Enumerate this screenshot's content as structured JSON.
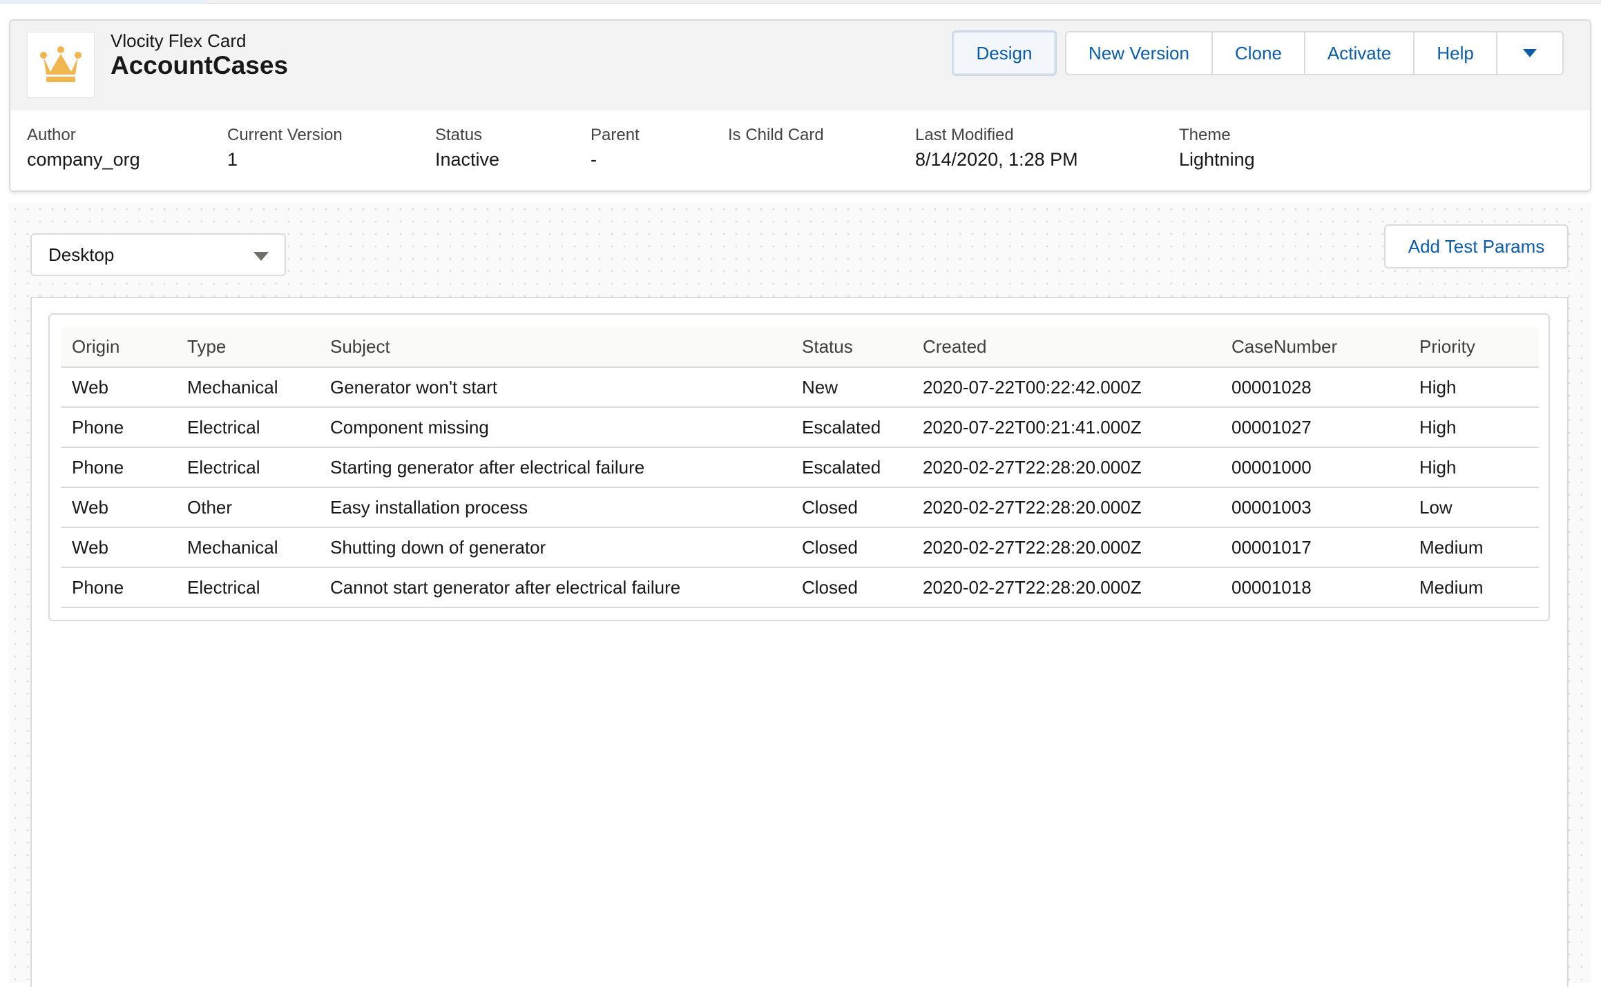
{
  "header": {
    "card_kind": "Vlocity Flex Card",
    "card_name": "AccountCases",
    "logo_icon": "crown-icon",
    "buttons": {
      "design": "Design",
      "new_version": "New Version",
      "clone": "Clone",
      "activate": "Activate",
      "help": "Help",
      "more_icon": "chevron-down-icon"
    },
    "meta": {
      "author": {
        "label": "Author",
        "value": "company_org"
      },
      "current_version": {
        "label": "Current Version",
        "value": "1"
      },
      "status": {
        "label": "Status",
        "value": "Inactive"
      },
      "parent": {
        "label": "Parent",
        "value": "-"
      },
      "is_child_card": {
        "label": "Is Child Card",
        "value": ""
      },
      "last_modified": {
        "label": "Last Modified",
        "value": "8/14/2020, 1:28 PM"
      },
      "theme": {
        "label": "Theme",
        "value": "Lightning"
      }
    }
  },
  "canvas": {
    "device_select": {
      "value": "Desktop"
    },
    "add_test_params": "Add Test Params"
  },
  "table": {
    "columns": [
      "Origin",
      "Type",
      "Subject",
      "Status",
      "Created",
      "CaseNumber",
      "Priority"
    ],
    "rows": [
      [
        "Web",
        "Mechanical",
        "Generator won't start",
        "New",
        "2020-07-22T00:22:42.000Z",
        "00001028",
        "High"
      ],
      [
        "Phone",
        "Electrical",
        "Component missing",
        "Escalated",
        "2020-07-22T00:21:41.000Z",
        "00001027",
        "High"
      ],
      [
        "Phone",
        "Electrical",
        "Starting generator after electrical failure",
        "Escalated",
        "2020-02-27T22:28:20.000Z",
        "00001000",
        "High"
      ],
      [
        "Web",
        "Other",
        "Easy installation process",
        "Closed",
        "2020-02-27T22:28:20.000Z",
        "00001003",
        "Low"
      ],
      [
        "Web",
        "Mechanical",
        "Shutting down of generator",
        "Closed",
        "2020-02-27T22:28:20.000Z",
        "00001017",
        "Medium"
      ],
      [
        "Phone",
        "Electrical",
        "Cannot start generator after electrical failure",
        "Closed",
        "2020-02-27T22:28:20.000Z",
        "00001018",
        "Medium"
      ]
    ]
  },
  "colors": {
    "brand_blue": "#0b5cab",
    "crown_gold": "#f2b651",
    "border": "#dddbda"
  }
}
